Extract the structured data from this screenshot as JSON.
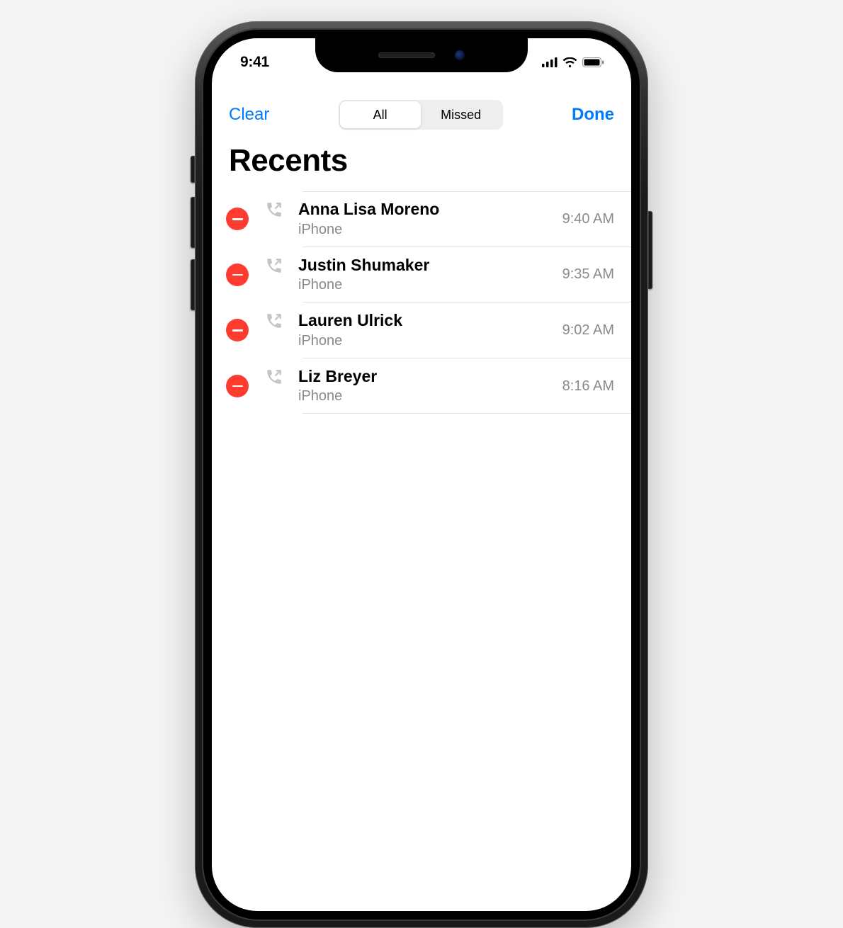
{
  "status": {
    "time": "9:41"
  },
  "nav": {
    "clear_label": "Clear",
    "done_label": "Done",
    "segmented": {
      "all_label": "All",
      "missed_label": "Missed",
      "active": "all"
    }
  },
  "title": "Recents",
  "calls": [
    {
      "name": "Anna Lisa Moreno",
      "sub": "iPhone",
      "time": "9:40 AM"
    },
    {
      "name": "Justin Shumaker",
      "sub": "iPhone",
      "time": "9:35 AM"
    },
    {
      "name": "Lauren Ulrick",
      "sub": "iPhone",
      "time": "9:02 AM"
    },
    {
      "name": "Liz Breyer",
      "sub": "iPhone",
      "time": "8:16 AM"
    }
  ]
}
